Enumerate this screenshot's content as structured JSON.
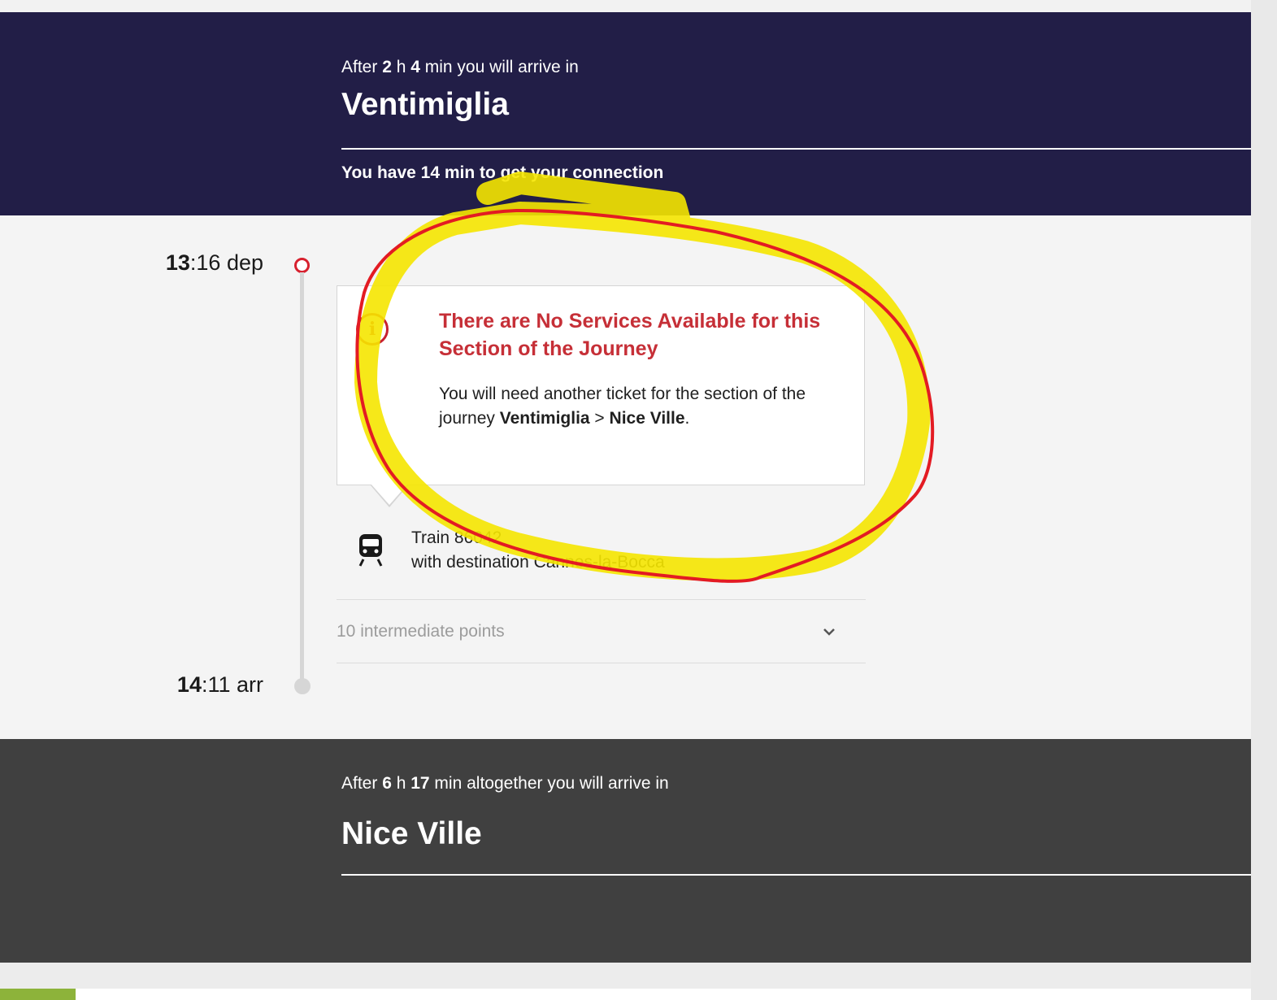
{
  "arrival": {
    "lead_prefix": "After ",
    "hours": "2",
    "h_unit": " h ",
    "minutes": "4",
    "lead_suffix": " min you will arrive in",
    "city": "Ventimiglia",
    "connection": "You have 14 min to get your connection"
  },
  "segment": {
    "dep_hour": "13",
    "dep_rest": ":16 dep",
    "arr_hour": "14",
    "arr_rest": ":11 arr",
    "notice_title": "There are No Services Available for this Section of the Journey",
    "notice_body_prefix": "You will need another ticket for the section of the journey ",
    "notice_from": "Ventimiglia",
    "notice_sep": " > ",
    "notice_to": "Nice Ville",
    "notice_end": ".",
    "train_line1": "Train 86042",
    "train_line2": "with destination Cannes-la-Bocca",
    "intermediate": "10 intermediate points"
  },
  "final": {
    "lead_prefix": "After ",
    "hours": "6",
    "h_unit": " h ",
    "minutes": "17",
    "lead_suffix": " min altogether you will arrive in",
    "city": "Nice Ville"
  },
  "colors": {
    "header_bg": "#221e47",
    "final_bg": "#404040",
    "alert_red": "#c62f37",
    "annotation_red": "#e31b23",
    "annotation_yellow": "#f5e600"
  },
  "icons": [
    "info-icon",
    "train-icon",
    "chevron-down-icon"
  ]
}
